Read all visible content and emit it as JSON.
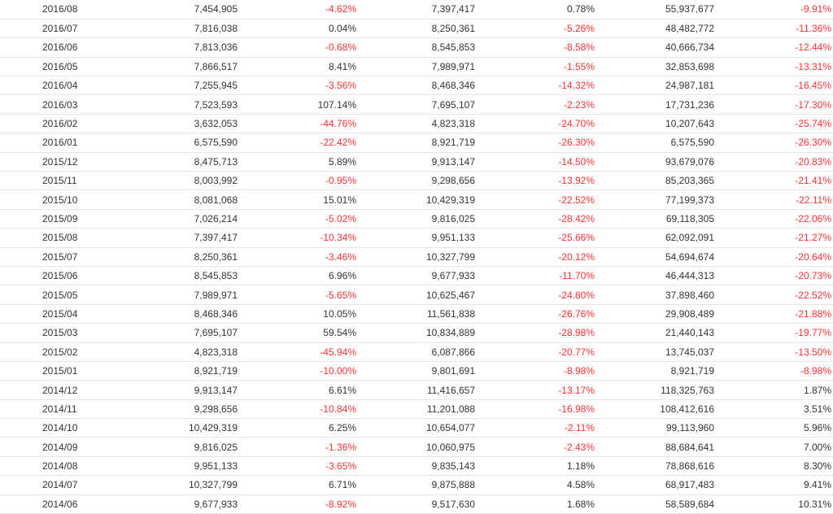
{
  "colors": {
    "negative": "#ff3333",
    "text": "#333333",
    "row_border": "#e5e5e5"
  },
  "rows": [
    [
      "2016/08",
      "7,454,905",
      "-4.62%",
      "7,397,417",
      "0.78%",
      "55,937,677",
      "-9.91%"
    ],
    [
      "2016/07",
      "7,816,038",
      "0.04%",
      "8,250,361",
      "-5.26%",
      "48,482,772",
      "-11.36%"
    ],
    [
      "2016/06",
      "7,813,036",
      "-0.68%",
      "8,545,853",
      "-8.58%",
      "40,666,734",
      "-12.44%"
    ],
    [
      "2016/05",
      "7,866,517",
      "8.41%",
      "7,989,971",
      "-1.55%",
      "32,853,698",
      "-13.31%"
    ],
    [
      "2016/04",
      "7,255,945",
      "-3.56%",
      "8,468,346",
      "-14.32%",
      "24,987,181",
      "-16.45%"
    ],
    [
      "2016/03",
      "7,523,593",
      "107.14%",
      "7,695,107",
      "-2.23%",
      "17,731,236",
      "-17.30%"
    ],
    [
      "2016/02",
      "3,632,053",
      "-44.76%",
      "4,823,318",
      "-24.70%",
      "10,207,643",
      "-25.74%"
    ],
    [
      "2016/01",
      "6,575,590",
      "-22.42%",
      "8,921,719",
      "-26.30%",
      "6,575,590",
      "-26.30%"
    ],
    [
      "2015/12",
      "8,475,713",
      "5.89%",
      "9,913,147",
      "-14.50%",
      "93,679,076",
      "-20.83%"
    ],
    [
      "2015/11",
      "8,003,992",
      "-0.95%",
      "9,298,656",
      "-13.92%",
      "85,203,365",
      "-21.41%"
    ],
    [
      "2015/10",
      "8,081,068",
      "15.01%",
      "10,429,319",
      "-22.52%",
      "77,199,373",
      "-22.11%"
    ],
    [
      "2015/09",
      "7,026,214",
      "-5.02%",
      "9,816,025",
      "-28.42%",
      "69,118,305",
      "-22.06%"
    ],
    [
      "2015/08",
      "7,397,417",
      "-10.34%",
      "9,951,133",
      "-25.66%",
      "62,092,091",
      "-21.27%"
    ],
    [
      "2015/07",
      "8,250,361",
      "-3.46%",
      "10,327,799",
      "-20.12%",
      "54,694,674",
      "-20.64%"
    ],
    [
      "2015/06",
      "8,545,853",
      "6.96%",
      "9,677,933",
      "-11.70%",
      "46,444,313",
      "-20.73%"
    ],
    [
      "2015/05",
      "7,989,971",
      "-5.65%",
      "10,625,467",
      "-24.80%",
      "37,898,460",
      "-22.52%"
    ],
    [
      "2015/04",
      "8,468,346",
      "10.05%",
      "11,561,838",
      "-26.76%",
      "29,908,489",
      "-21.88%"
    ],
    [
      "2015/03",
      "7,695,107",
      "59.54%",
      "10,834,889",
      "-28.98%",
      "21,440,143",
      "-19.77%"
    ],
    [
      "2015/02",
      "4,823,318",
      "-45.94%",
      "6,087,866",
      "-20.77%",
      "13,745,037",
      "-13.50%"
    ],
    [
      "2015/01",
      "8,921,719",
      "-10.00%",
      "9,801,691",
      "-8.98%",
      "8,921,719",
      "-8.98%"
    ],
    [
      "2014/12",
      "9,913,147",
      "6.61%",
      "11,416,657",
      "-13.17%",
      "118,325,763",
      "1.87%"
    ],
    [
      "2014/11",
      "9,298,656",
      "-10.84%",
      "11,201,088",
      "-16.98%",
      "108,412,616",
      "3.51%"
    ],
    [
      "2014/10",
      "10,429,319",
      "6.25%",
      "10,654,077",
      "-2.11%",
      "99,113,960",
      "5.96%"
    ],
    [
      "2014/09",
      "9,816,025",
      "-1.36%",
      "10,060,975",
      "-2.43%",
      "88,684,641",
      "7.00%"
    ],
    [
      "2014/08",
      "9,951,133",
      "-3.65%",
      "9,835,143",
      "1.18%",
      "78,868,616",
      "8.30%"
    ],
    [
      "2014/07",
      "10,327,799",
      "6.71%",
      "9,875,888",
      "4.58%",
      "68,917,483",
      "9.41%"
    ],
    [
      "2014/06",
      "9,677,933",
      "-8.92%",
      "9,517,630",
      "1.68%",
      "58,589,684",
      "10.31%"
    ]
  ]
}
